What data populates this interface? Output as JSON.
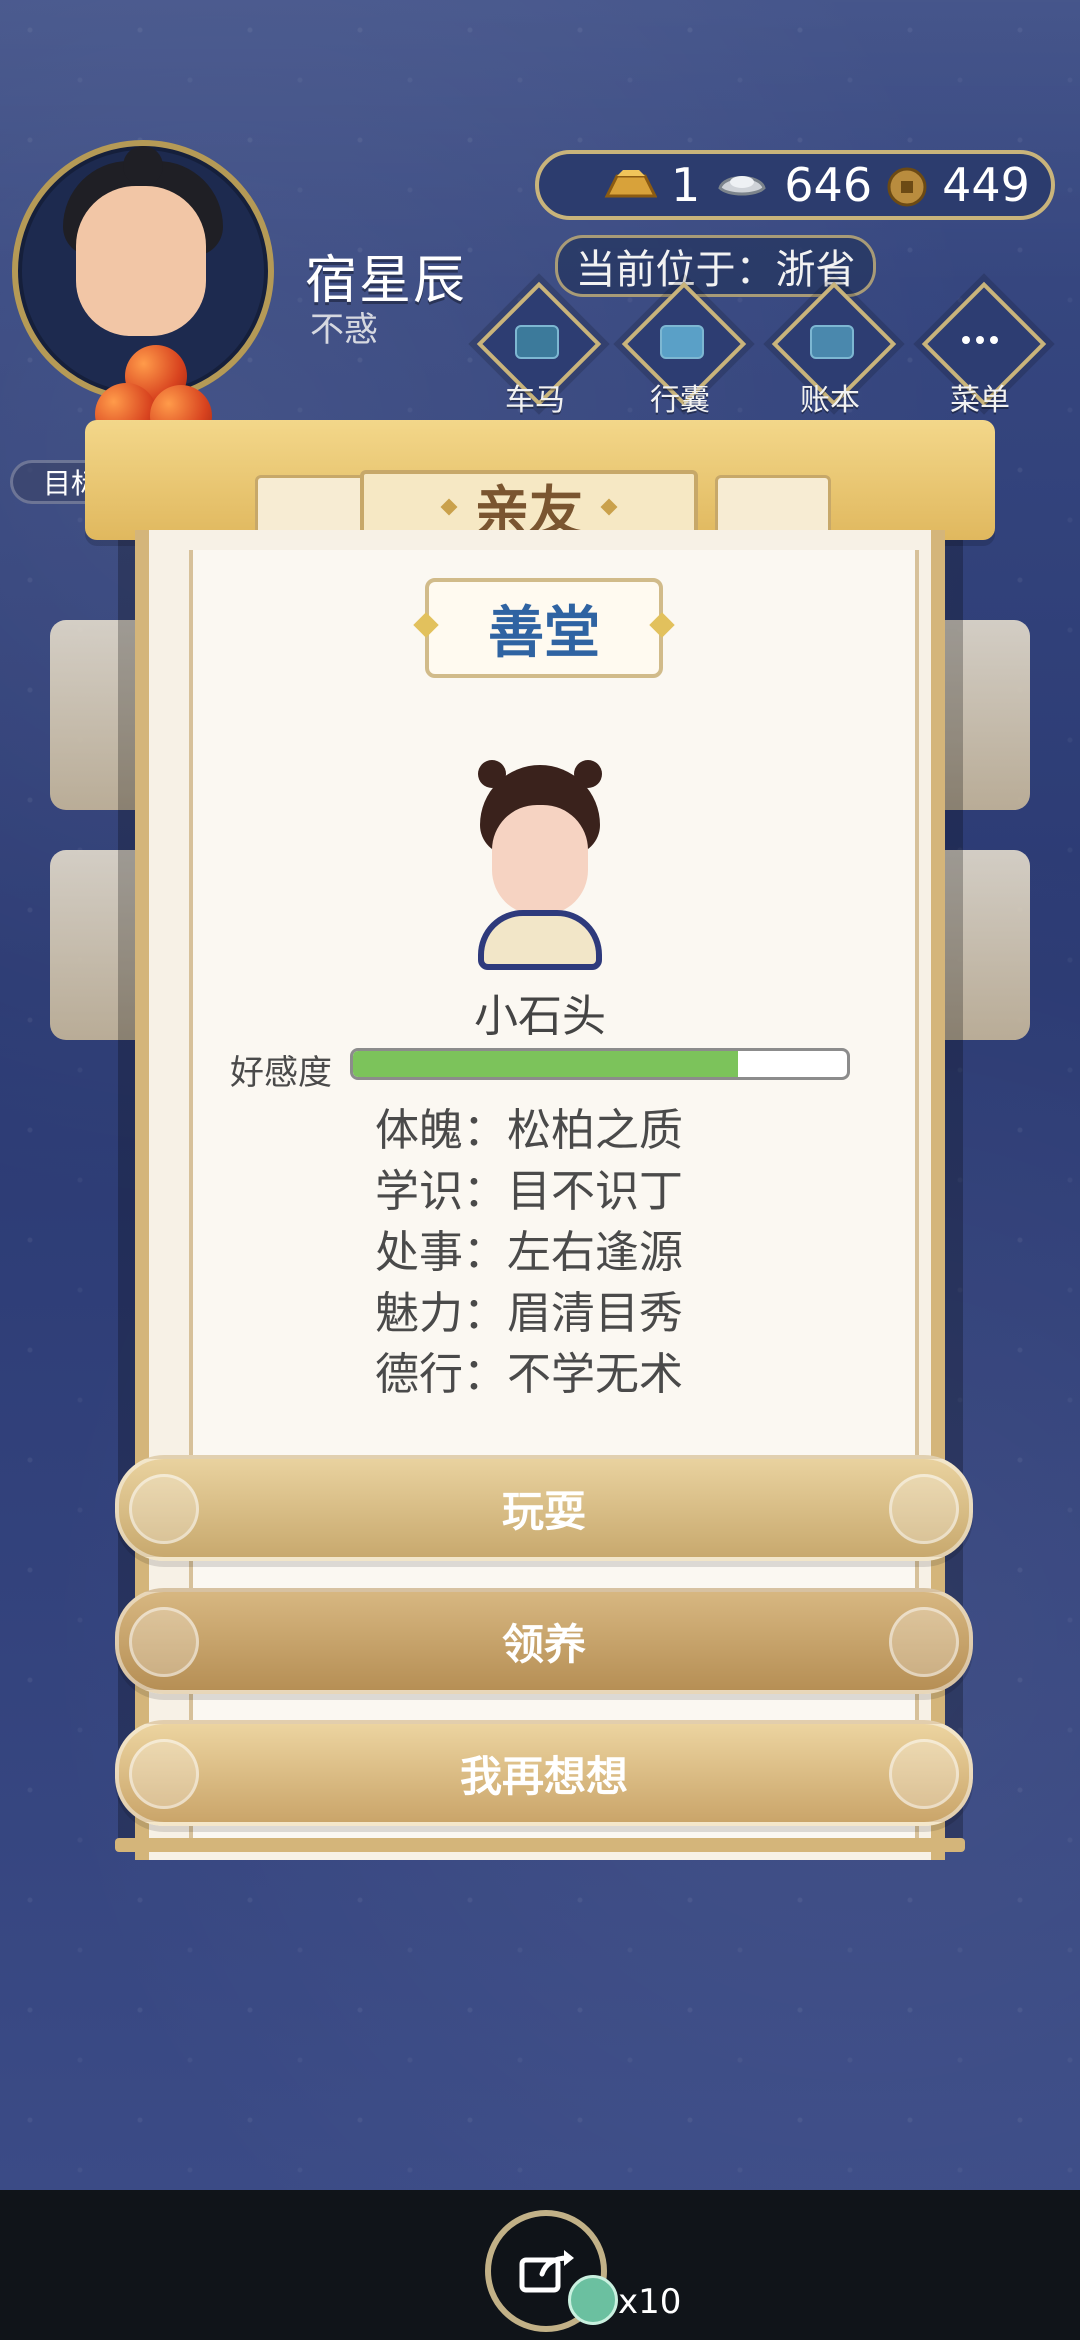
{
  "player": {
    "name": "宿星辰",
    "title": "不惑"
  },
  "currency": {
    "gold": "1",
    "silver": "646",
    "coins": "449"
  },
  "location": "当前位于：浙省",
  "nav": [
    {
      "label": "车马",
      "icon": "carriage-icon"
    },
    {
      "label": "行囊",
      "icon": "bag-icon"
    },
    {
      "label": "账本",
      "icon": "ledger-icon"
    },
    {
      "label": "菜单",
      "icon": "menu-icon"
    }
  ],
  "goal_label": "目标",
  "modal": {
    "title": "亲友",
    "place": "善堂",
    "child_name": "小石头",
    "favor_label": "好感度",
    "favor_fraction": 0.78,
    "stats": [
      {
        "label": "体魄：",
        "value": "松柏之质"
      },
      {
        "label": "学识：",
        "value": "目不识丁"
      },
      {
        "label": "处事：",
        "value": "左右逢源"
      },
      {
        "label": "魅力：",
        "value": "眉清目秀"
      },
      {
        "label": "德行：",
        "value": "不学无术"
      }
    ],
    "buttons": {
      "play": "玩耍",
      "adopt": "领养",
      "think": "我再想想"
    }
  },
  "bottom": {
    "reward_count": "x10"
  },
  "colors": {
    "background": "#2a3f78",
    "gold_frame": "#c9b47b",
    "favor_fill": "#7cc35b",
    "place_text": "#2f63a2"
  }
}
